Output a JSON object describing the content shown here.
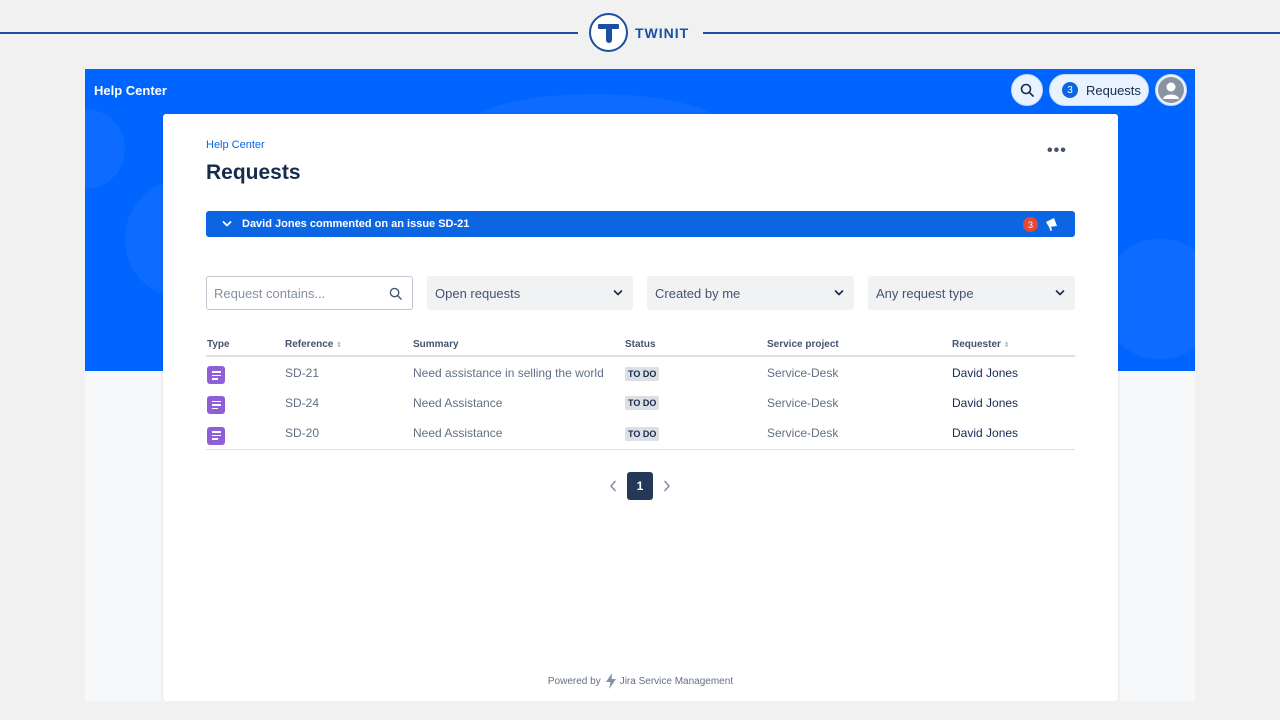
{
  "brand": {
    "name": "TWINIT",
    "color": "#1a4fa3"
  },
  "topnav": {
    "title": "Help Center",
    "search_icon": "search-icon",
    "requests_count": "3",
    "requests_label": "Requests",
    "avatar_icon": "user-avatar-icon",
    "background": "#0065ff"
  },
  "page": {
    "breadcrumb": "Help Center",
    "title": "Requests",
    "more_label": "•••"
  },
  "notification": {
    "text": "David Jones commented on an issue SD-21",
    "count": "3",
    "icon": "megaphone-icon"
  },
  "filters": {
    "search_placeholder": "Request contains...",
    "status": "Open requests",
    "creator": "Created by me",
    "request_type": "Any request type"
  },
  "table": {
    "headers": {
      "type": "Type",
      "reference": "Reference",
      "summary": "Summary",
      "status": "Status",
      "service_project": "Service project",
      "requester": "Requester"
    },
    "rows": [
      {
        "reference": "SD-21",
        "summary": "Need assistance in selling the world",
        "status": "TO DO",
        "service_project": "Service-Desk",
        "requester": "David Jones"
      },
      {
        "reference": "SD-24",
        "summary": "Need Assistance",
        "status": "TO DO",
        "service_project": "Service-Desk",
        "requester": "David Jones"
      },
      {
        "reference": "SD-20",
        "summary": "Need Assistance",
        "status": "TO DO",
        "service_project": "Service-Desk",
        "requester": "David Jones"
      }
    ]
  },
  "pagination": {
    "current": "1"
  },
  "footer": {
    "powered_by": "Powered by",
    "product": "Jira Service Management"
  },
  "colors": {
    "primary": "#0c66e4",
    "type_icon": "#8f5fd7",
    "badge_red": "#e34935",
    "page_current": "#253858"
  }
}
